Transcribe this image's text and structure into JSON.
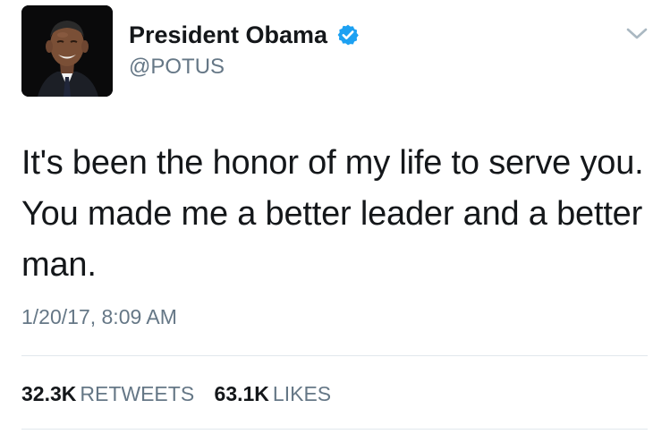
{
  "tweet": {
    "display_name": "President Obama",
    "handle": "@POTUS",
    "text": "It's been the honor of my life to serve you. You made me a better leader and a better man.",
    "timestamp": "1/20/17, 8:09 AM",
    "retweets_count": "32.3K",
    "retweets_label": "RETWEETS",
    "likes_count": "63.1K",
    "likes_label": "LIKES"
  },
  "icons": {
    "verified": "verified-badge-icon",
    "menu": "chevron-down-icon"
  },
  "colors": {
    "verified_blue": "#1da1f2",
    "secondary_text": "#657786",
    "primary_text": "#14171a",
    "divider": "#e1e8ed"
  }
}
